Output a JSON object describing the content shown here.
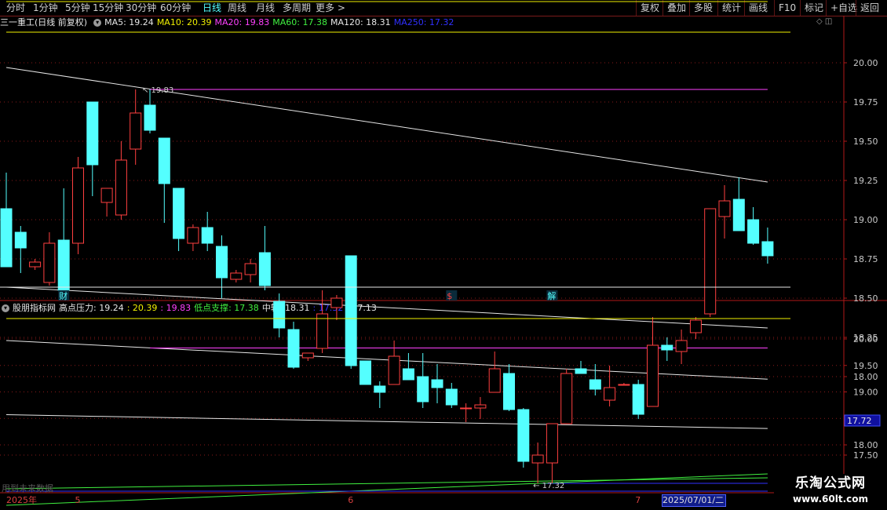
{
  "toolbar": {
    "left": [
      {
        "label": "分时",
        "active": false
      },
      {
        "label": "1分钟",
        "active": false
      },
      {
        "label": "5分钟",
        "active": false
      },
      {
        "label": "15分钟",
        "active": false
      },
      {
        "label": "30分钟",
        "active": false
      },
      {
        "label": "60分钟",
        "active": false
      },
      {
        "label": "日线",
        "active": true
      },
      {
        "label": "周线",
        "active": false
      },
      {
        "label": "月线",
        "active": false
      },
      {
        "label": "多周期",
        "active": false
      },
      {
        "label": "更多 >",
        "active": false
      }
    ],
    "right": [
      "复权",
      "叠加",
      "多股",
      "统计",
      "画线",
      "F10",
      "标记",
      "+自选",
      "返回"
    ]
  },
  "main_info": {
    "title": "三一重工(日线 前复权)",
    "items": [
      {
        "text": "MA5: 19.24",
        "color": "#e6e6e6"
      },
      {
        "text": "MA10: 20.39",
        "color": "#f0f000"
      },
      {
        "text": "MA20: 19.83",
        "color": "#ff40ff"
      },
      {
        "text": "MA60: 17.38",
        "color": "#40f040"
      },
      {
        "text": "MA120: 18.31",
        "color": "#e6e6e6"
      },
      {
        "text": "MA250: 17.32",
        "color": "#3030ff"
      }
    ],
    "right_icons": "◇ ◫"
  },
  "sub_info": {
    "title": "股朋指标网",
    "items": [
      {
        "text": "高点压力: 19.24",
        "color": "#e6e6e6"
      },
      {
        "text": ": 20.39",
        "color": "#f0f000"
      },
      {
        "text": ": 19.83",
        "color": "#ff40ff"
      },
      {
        "text": "低点支撑: 17.38",
        "color": "#40f040"
      },
      {
        "text": "中轨: 18.31",
        "color": "#e6e6e6"
      },
      {
        "text": ": 17.32",
        "color": "#3030ff"
      },
      {
        "text": ": 17.13",
        "color": "#e6e6e6"
      }
    ]
  },
  "colors": {
    "up": "#ff4040",
    "down": "#54ffff",
    "axis": "#b01818",
    "grid": "#8a1a1a"
  },
  "chart_data": [
    {
      "type": "candlestick",
      "title": "三一重工(日线 前复权)",
      "yticks": [
        20.0,
        19.75,
        19.5,
        19.25,
        19.0,
        18.75,
        18.5,
        18.25,
        18.0,
        17.5
      ],
      "price_label": "17.72",
      "annotations": {
        "high": "19.83",
        "low": "17.32"
      },
      "markers": [
        {
          "text": "财",
          "index": 4,
          "color": "#54ffff"
        },
        {
          "text": "$",
          "index": 31,
          "color": "#ff4040"
        },
        {
          "text": "解",
          "index": 38,
          "color": "#54ffff"
        }
      ],
      "candles": [
        {
          "o": 19.07,
          "h": 19.3,
          "l": 18.7,
          "c": 18.7
        },
        {
          "o": 18.92,
          "h": 18.96,
          "l": 18.66,
          "c": 18.82
        },
        {
          "o": 18.7,
          "h": 18.75,
          "l": 18.68,
          "c": 18.73
        },
        {
          "o": 18.6,
          "h": 18.92,
          "l": 18.58,
          "c": 18.85
        },
        {
          "o": 18.87,
          "h": 19.2,
          "l": 18.55,
          "c": 18.55
        },
        {
          "o": 18.85,
          "h": 19.4,
          "l": 18.78,
          "c": 19.33
        },
        {
          "o": 19.75,
          "h": 19.75,
          "l": 19.15,
          "c": 19.35
        },
        {
          "o": 19.11,
          "h": 19.2,
          "l": 19.02,
          "c": 19.2
        },
        {
          "o": 19.03,
          "h": 19.5,
          "l": 19.0,
          "c": 19.38
        },
        {
          "o": 19.45,
          "h": 19.83,
          "l": 19.35,
          "c": 19.68
        },
        {
          "o": 19.73,
          "h": 19.83,
          "l": 19.55,
          "c": 19.57
        },
        {
          "o": 19.52,
          "h": 19.52,
          "l": 18.98,
          "c": 19.23
        },
        {
          "o": 19.2,
          "h": 19.2,
          "l": 18.8,
          "c": 18.88
        },
        {
          "o": 18.85,
          "h": 18.97,
          "l": 18.8,
          "c": 18.95
        },
        {
          "o": 18.95,
          "h": 19.05,
          "l": 18.8,
          "c": 18.85
        },
        {
          "o": 18.83,
          "h": 18.9,
          "l": 18.5,
          "c": 18.63
        },
        {
          "o": 18.62,
          "h": 18.68,
          "l": 18.6,
          "c": 18.66
        },
        {
          "o": 18.65,
          "h": 18.75,
          "l": 18.6,
          "c": 18.72
        },
        {
          "o": 18.79,
          "h": 18.96,
          "l": 18.55,
          "c": 18.58
        },
        {
          "o": 18.48,
          "h": 18.53,
          "l": 18.25,
          "c": 18.31
        },
        {
          "o": 18.3,
          "h": 18.35,
          "l": 18.05,
          "c": 18.06
        },
        {
          "o": 18.12,
          "h": 18.12,
          "l": 18.1,
          "c": 18.15
        },
        {
          "o": 18.18,
          "h": 18.55,
          "l": 18.15,
          "c": 18.4
        },
        {
          "o": 18.44,
          "h": 18.52,
          "l": 18.36,
          "c": 18.5
        },
        {
          "o": 18.77,
          "h": 18.77,
          "l": 18.05,
          "c": 18.07
        },
        {
          "o": 18.1,
          "h": 18.1,
          "l": 17.95,
          "c": 17.95
        },
        {
          "o": 17.94,
          "h": 17.97,
          "l": 17.8,
          "c": 17.9
        },
        {
          "o": 17.95,
          "h": 18.23,
          "l": 17.95,
          "c": 18.13
        },
        {
          "o": 18.05,
          "h": 18.15,
          "l": 17.98,
          "c": 17.98
        },
        {
          "o": 18.0,
          "h": 18.15,
          "l": 17.8,
          "c": 17.84
        },
        {
          "o": 17.98,
          "h": 18.08,
          "l": 17.83,
          "c": 17.93
        },
        {
          "o": 17.92,
          "h": 17.96,
          "l": 17.8,
          "c": 17.82
        },
        {
          "o": 17.8,
          "h": 17.83,
          "l": 17.71,
          "c": 17.8
        },
        {
          "o": 17.8,
          "h": 17.87,
          "l": 17.73,
          "c": 17.82
        },
        {
          "o": 17.9,
          "h": 18.16,
          "l": 17.9,
          "c": 18.05
        },
        {
          "o": 18.02,
          "h": 18.08,
          "l": 17.78,
          "c": 17.79
        },
        {
          "o": 17.79,
          "h": 17.8,
          "l": 17.42,
          "c": 17.46
        },
        {
          "o": 17.45,
          "h": 17.58,
          "l": 17.32,
          "c": 17.5
        },
        {
          "o": 17.45,
          "h": 17.69,
          "l": 17.32,
          "c": 17.7
        },
        {
          "o": 17.7,
          "h": 18.05,
          "l": 17.7,
          "c": 18.02
        },
        {
          "o": 18.05,
          "h": 18.1,
          "l": 18.02,
          "c": 18.02
        },
        {
          "o": 17.98,
          "h": 18.08,
          "l": 17.88,
          "c": 17.92
        },
        {
          "o": 17.85,
          "h": 18.07,
          "l": 17.81,
          "c": 17.93
        },
        {
          "o": 17.95,
          "h": 17.96,
          "l": 17.95,
          "c": 17.95
        },
        {
          "o": 17.95,
          "h": 17.98,
          "l": 17.73,
          "c": 17.76
        },
        {
          "o": 17.81,
          "h": 18.38,
          "l": 17.81,
          "c": 18.2
        },
        {
          "o": 18.2,
          "h": 18.25,
          "l": 18.1,
          "c": 18.17
        },
        {
          "o": 18.16,
          "h": 18.3,
          "l": 18.08,
          "c": 18.23
        },
        {
          "o": 18.28,
          "h": 18.38,
          "l": 18.24,
          "c": 18.36
        },
        {
          "o": 18.4,
          "h": 19.07,
          "l": 18.38,
          "c": 19.07
        },
        {
          "o": 19.02,
          "h": 19.22,
          "l": 18.88,
          "c": 19.12
        },
        {
          "o": 19.13,
          "h": 19.27,
          "l": 18.93,
          "c": 18.93
        },
        {
          "o": 19.0,
          "h": 19.08,
          "l": 18.84,
          "c": 18.85
        },
        {
          "o": 18.86,
          "h": 18.95,
          "l": 18.72,
          "c": 18.77
        }
      ],
      "lines": [
        {
          "name": "高点压力",
          "color": "#e6e6e6",
          "from": [
            0,
            19.97
          ],
          "to": [
            53,
            19.24
          ]
        },
        {
          "name": "中轨",
          "color": "#e6e6e6",
          "from": [
            0,
            18.57
          ],
          "to": [
            53,
            18.31
          ]
        },
        {
          "name": "MA10",
          "color": "#f0f000",
          "value": 20.39
        },
        {
          "name": "MA20",
          "color": "#ff40ff",
          "value": 19.83,
          "start": 10
        },
        {
          "name": "MA250",
          "color": "#3030ff",
          "value": 17.32,
          "start": 37
        }
      ],
      "support": {
        "name": "低点支撑",
        "color": "#40f040",
        "from": [
          0,
          17.18
        ],
        "to": [
          53,
          17.38
        ]
      }
    },
    {
      "type": "line",
      "title": "股朋指标网",
      "yticks": [
        20.0,
        19.5,
        19.0,
        18.5,
        18.0
      ],
      "lines": [
        {
          "name": "高点压力",
          "color": "#e6e6e6",
          "from": [
            0,
            19.97
          ],
          "to": [
            53,
            19.24
          ]
        },
        {
          "name": "中轨",
          "color": "#e6e6e6",
          "from": [
            0,
            18.57
          ],
          "to": [
            53,
            18.31
          ]
        },
        {
          "name": "MA10",
          "color": "#f0f000",
          "value": 20.39
        },
        {
          "name": "MA20",
          "color": "#ff40ff",
          "value": 19.83,
          "start": 10
        }
      ],
      "support": {
        "name": "低点支撑",
        "color": "#40f040",
        "from": [
          0,
          17.2
        ],
        "to": [
          53,
          17.38
        ]
      },
      "future_label": "用到未来数据"
    }
  ],
  "datebar": {
    "labels": [
      {
        "text": "2025年",
        "index": 0
      },
      {
        "text": "5",
        "index": 5
      },
      {
        "text": "6",
        "index": 24
      },
      {
        "text": "7",
        "index": 44
      }
    ],
    "current": "2025/07/01/二"
  },
  "logo": {
    "line1": "乐淘公式网",
    "line2": "www.60lt.com"
  }
}
